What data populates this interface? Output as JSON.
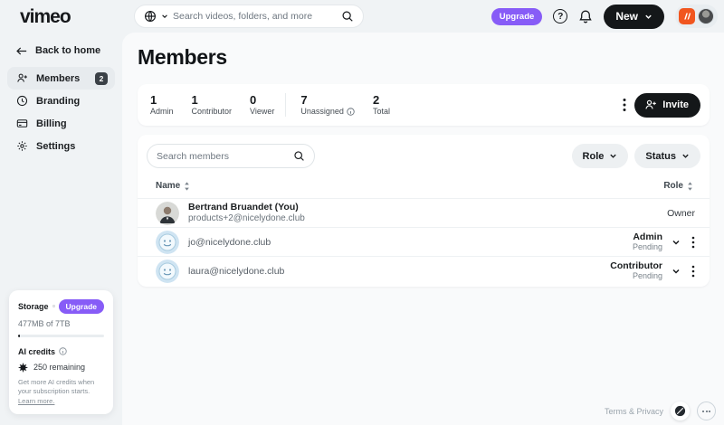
{
  "topbar": {
    "logo": "vimeo",
    "search_placeholder": "Search videos, folders, and more",
    "upgrade_label": "Upgrade",
    "help_label": "?",
    "new_label": "New"
  },
  "sidebar": {
    "back_label": "Back to home",
    "items": [
      {
        "label": "Members",
        "badge": "2"
      },
      {
        "label": "Branding"
      },
      {
        "label": "Billing"
      },
      {
        "label": "Settings"
      }
    ]
  },
  "main": {
    "title": "Members",
    "stats": [
      {
        "value": "1",
        "label": "Admin"
      },
      {
        "value": "1",
        "label": "Contributor"
      },
      {
        "value": "0",
        "label": "Viewer"
      },
      {
        "value": "7",
        "label": "Unassigned"
      },
      {
        "value": "2",
        "label": "Total"
      }
    ],
    "invite_label": "Invite",
    "filters": {
      "search_placeholder": "Search members",
      "role_label": "Role",
      "status_label": "Status"
    },
    "table": {
      "col_name": "Name",
      "col_role": "Role",
      "rows": [
        {
          "name": "Bertrand Bruandet (You)",
          "email": "products+2@nicelydone.club",
          "role": "Owner",
          "status": ""
        },
        {
          "name": "",
          "email": "jo@nicelydone.club",
          "role": "Admin",
          "status": "Pending"
        },
        {
          "name": "",
          "email": "laura@nicelydone.club",
          "role": "Contributor",
          "status": "Pending"
        }
      ]
    }
  },
  "storage_card": {
    "title": "Storage",
    "upgrade_label": "Upgrade",
    "usage": "477MB of 7TB",
    "ai_title": "AI credits",
    "ai_remaining": "250 remaining",
    "ai_note": "Get more AI credits when your subscription starts.",
    "ai_link": "Learn more."
  },
  "footer": {
    "terms": "Terms & Privacy"
  },
  "colors": {
    "accent_purple": "#875cf7",
    "brand_orange": "#f1561f",
    "button_black": "#141719",
    "avatar_blue": "#d3e7f4",
    "page_bg": "#f0f3f5",
    "main_bg": "#f9fafb"
  }
}
